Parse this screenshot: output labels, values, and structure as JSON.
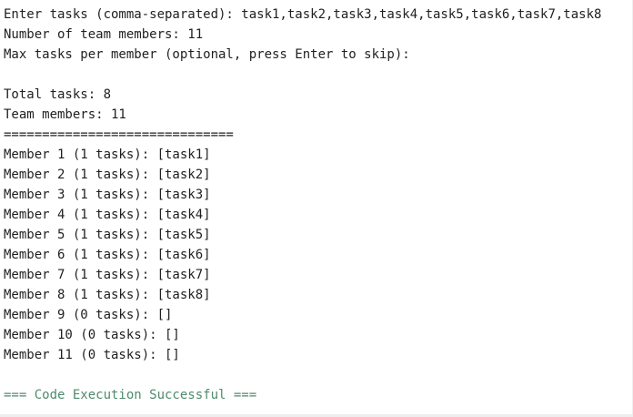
{
  "prompts": {
    "tasks_prompt": "Enter tasks (comma-separated): task1,task2,task3,task4,task5,task6,task7,task8",
    "members_prompt": "Number of team members: 11",
    "max_prompt": "Max tasks per member (optional, press Enter to skip):"
  },
  "summary": {
    "total": "Total tasks: 8",
    "members": "Team members: 11",
    "separator": "=============================="
  },
  "assignments": [
    "Member 1 (1 tasks): [task1]",
    "Member 2 (1 tasks): [task2]",
    "Member 3 (1 tasks): [task3]",
    "Member 4 (1 tasks): [task4]",
    "Member 5 (1 tasks): [task5]",
    "Member 6 (1 tasks): [task6]",
    "Member 7 (1 tasks): [task7]",
    "Member 8 (1 tasks): [task8]",
    "Member 9 (0 tasks): []",
    "Member 10 (0 tasks): []",
    "Member 11 (0 tasks): []"
  ],
  "status": {
    "message": "=== Code Execution Successful ==="
  },
  "colors": {
    "text": "#1f1f1f",
    "success": "#4f8a6e",
    "background": "#ffffff"
  }
}
